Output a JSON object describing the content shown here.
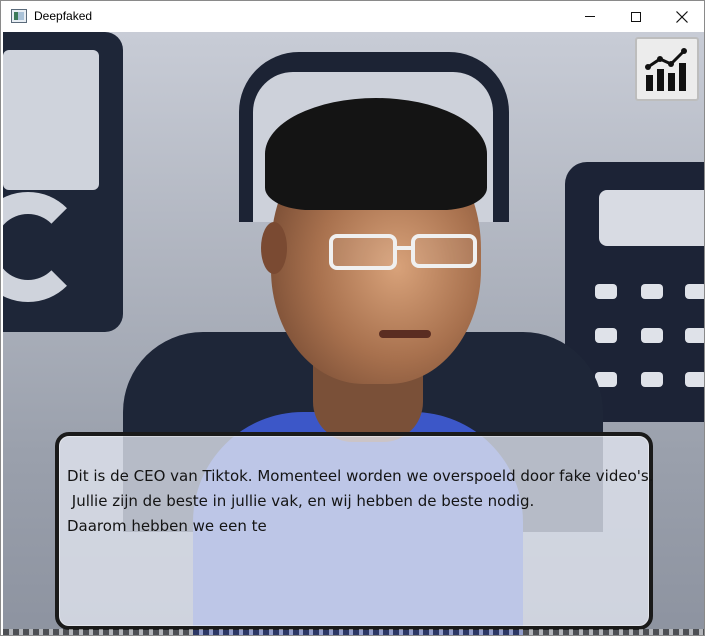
{
  "window": {
    "title": "Deepfaked",
    "controls": {
      "minimize": "minimize",
      "maximize": "maximize",
      "close": "close"
    }
  },
  "toolbar": {
    "stats_icon": "bar-chart-trend-icon"
  },
  "dialog": {
    "lines": [
      "Dit is de CEO van Tiktok. Momenteel worden we overspoeld door fake video's.",
      " Jullie zijn de beste in jullie vak, en wij hebben de beste nodig.",
      "Daarom hebben we een te"
    ]
  },
  "colors": {
    "dialog_border": "#1a1a1a",
    "shirt": "#3c57c8",
    "scene_dark": "#1e2638"
  }
}
